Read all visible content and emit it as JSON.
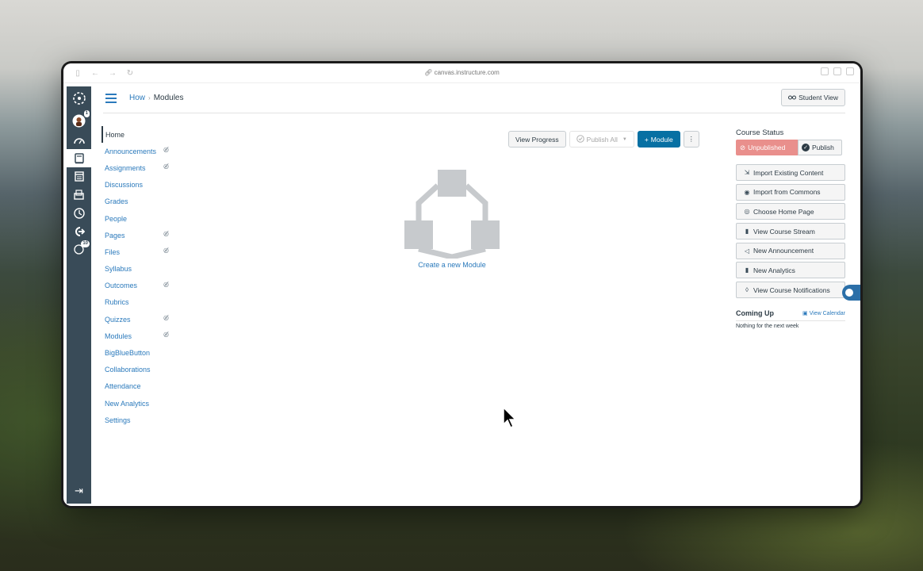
{
  "browser": {
    "url": "canvas.instructure.com"
  },
  "global_nav": {
    "items": [
      {
        "name": "canvas-logo",
        "icon": "canvas-logo-icon"
      },
      {
        "name": "account",
        "icon": "avatar-icon",
        "badge": "1"
      },
      {
        "name": "dashboard",
        "icon": "dashboard-icon"
      },
      {
        "name": "courses",
        "icon": "book-icon"
      },
      {
        "name": "calendar",
        "icon": "calendar-icon"
      },
      {
        "name": "inbox",
        "icon": "inbox-icon"
      },
      {
        "name": "history",
        "icon": "clock-icon"
      },
      {
        "name": "commons",
        "icon": "commons-icon"
      },
      {
        "name": "help",
        "icon": "help-icon",
        "badge": "10"
      }
    ],
    "collapse_icon": "collapse-icon"
  },
  "header": {
    "breadcrumb_course": "How",
    "breadcrumb_separator": "›",
    "breadcrumb_page": "Modules",
    "student_view_label": "Student View"
  },
  "course_nav": {
    "items": [
      {
        "label": "Home",
        "active": true,
        "hidden": false
      },
      {
        "label": "Announcements",
        "active": false,
        "hidden": true
      },
      {
        "label": "Assignments",
        "active": false,
        "hidden": true
      },
      {
        "label": "Discussions",
        "active": false,
        "hidden": false
      },
      {
        "label": "Grades",
        "active": false,
        "hidden": false
      },
      {
        "label": "People",
        "active": false,
        "hidden": false
      },
      {
        "label": "Pages",
        "active": false,
        "hidden": true
      },
      {
        "label": "Files",
        "active": false,
        "hidden": true
      },
      {
        "label": "Syllabus",
        "active": false,
        "hidden": false
      },
      {
        "label": "Outcomes",
        "active": false,
        "hidden": true
      },
      {
        "label": "Rubrics",
        "active": false,
        "hidden": false
      },
      {
        "label": "Quizzes",
        "active": false,
        "hidden": true
      },
      {
        "label": "Modules",
        "active": false,
        "hidden": true
      },
      {
        "label": "BigBlueButton",
        "active": false,
        "hidden": false
      },
      {
        "label": "Collaborations",
        "active": false,
        "hidden": false
      },
      {
        "label": "Attendance",
        "active": false,
        "hidden": false
      },
      {
        "label": "New Analytics",
        "active": false,
        "hidden": false
      },
      {
        "label": "Settings",
        "active": false,
        "hidden": false
      }
    ]
  },
  "toolbar": {
    "view_progress": "View Progress",
    "publish_all": "Publish All",
    "add_module": "Module",
    "add_prefix": "+"
  },
  "main": {
    "create_module_link": "Create a new Module"
  },
  "sidebar": {
    "course_status_title": "Course Status",
    "unpublished_label": "Unpublished",
    "publish_label": "Publish",
    "buttons": [
      {
        "label": "Import Existing Content",
        "icon": "import-icon"
      },
      {
        "label": "Import from Commons",
        "icon": "commons-icon"
      },
      {
        "label": "Choose Home Page",
        "icon": "target-icon"
      },
      {
        "label": "View Course Stream",
        "icon": "bar-chart-icon"
      },
      {
        "label": "New Announcement",
        "icon": "megaphone-icon"
      },
      {
        "label": "New Analytics",
        "icon": "bar-chart-icon"
      },
      {
        "label": "View Course Notifications",
        "icon": "bell-icon"
      }
    ],
    "coming_up_title": "Coming Up",
    "view_calendar": "View Calendar",
    "nothing_text": "Nothing for the next week"
  },
  "colors": {
    "link": "#2b7abc",
    "global_nav_bg": "#394b58",
    "primary_button": "#0770a3",
    "unpublished": "#e98f8c"
  }
}
